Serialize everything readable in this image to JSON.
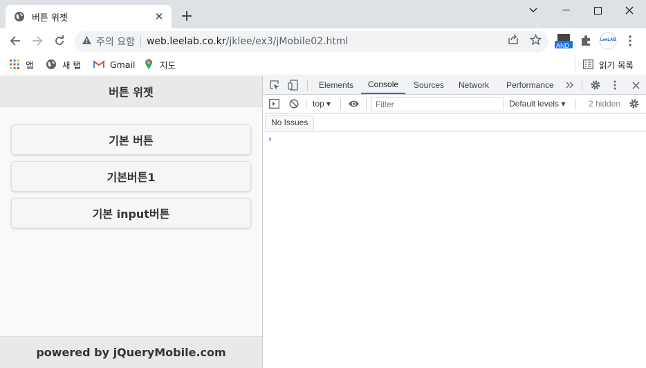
{
  "browser": {
    "tab_title": "버튼 위젯",
    "url_security": "주의 요함",
    "url_host": "web.leelab.co.kr",
    "url_path": "/jklee/ex3/jMobile02.html",
    "ext_badge": "AND",
    "ext_profile": "LeeLAB"
  },
  "bookmarks": [
    {
      "label": "앱",
      "icon": "apps-grid-icon"
    },
    {
      "label": "새 탭",
      "icon": "globe-icon"
    },
    {
      "label": "Gmail",
      "icon": "gmail-icon"
    },
    {
      "label": "지도",
      "icon": "maps-pin-icon"
    }
  ],
  "reading_list": "읽기 목록",
  "page": {
    "header_title": "버튼 위젯",
    "buttons": [
      "기본 버튼",
      "기본버튼1",
      "기본 input버튼"
    ],
    "footer": "powered by jQueryMobile.com"
  },
  "devtools": {
    "tabs": [
      "Elements",
      "Console",
      "Sources",
      "Network",
      "Performance"
    ],
    "active_tab": "Console",
    "context": "top",
    "filter_placeholder": "Filter",
    "levels": "Default levels",
    "hidden": "2 hidden",
    "issues": "No Issues",
    "prompt": "›"
  },
  "colors": {
    "accent": "#1a73e8",
    "tabstrip": "#dee1e6",
    "jqm_bar": "#e9e9e9"
  }
}
